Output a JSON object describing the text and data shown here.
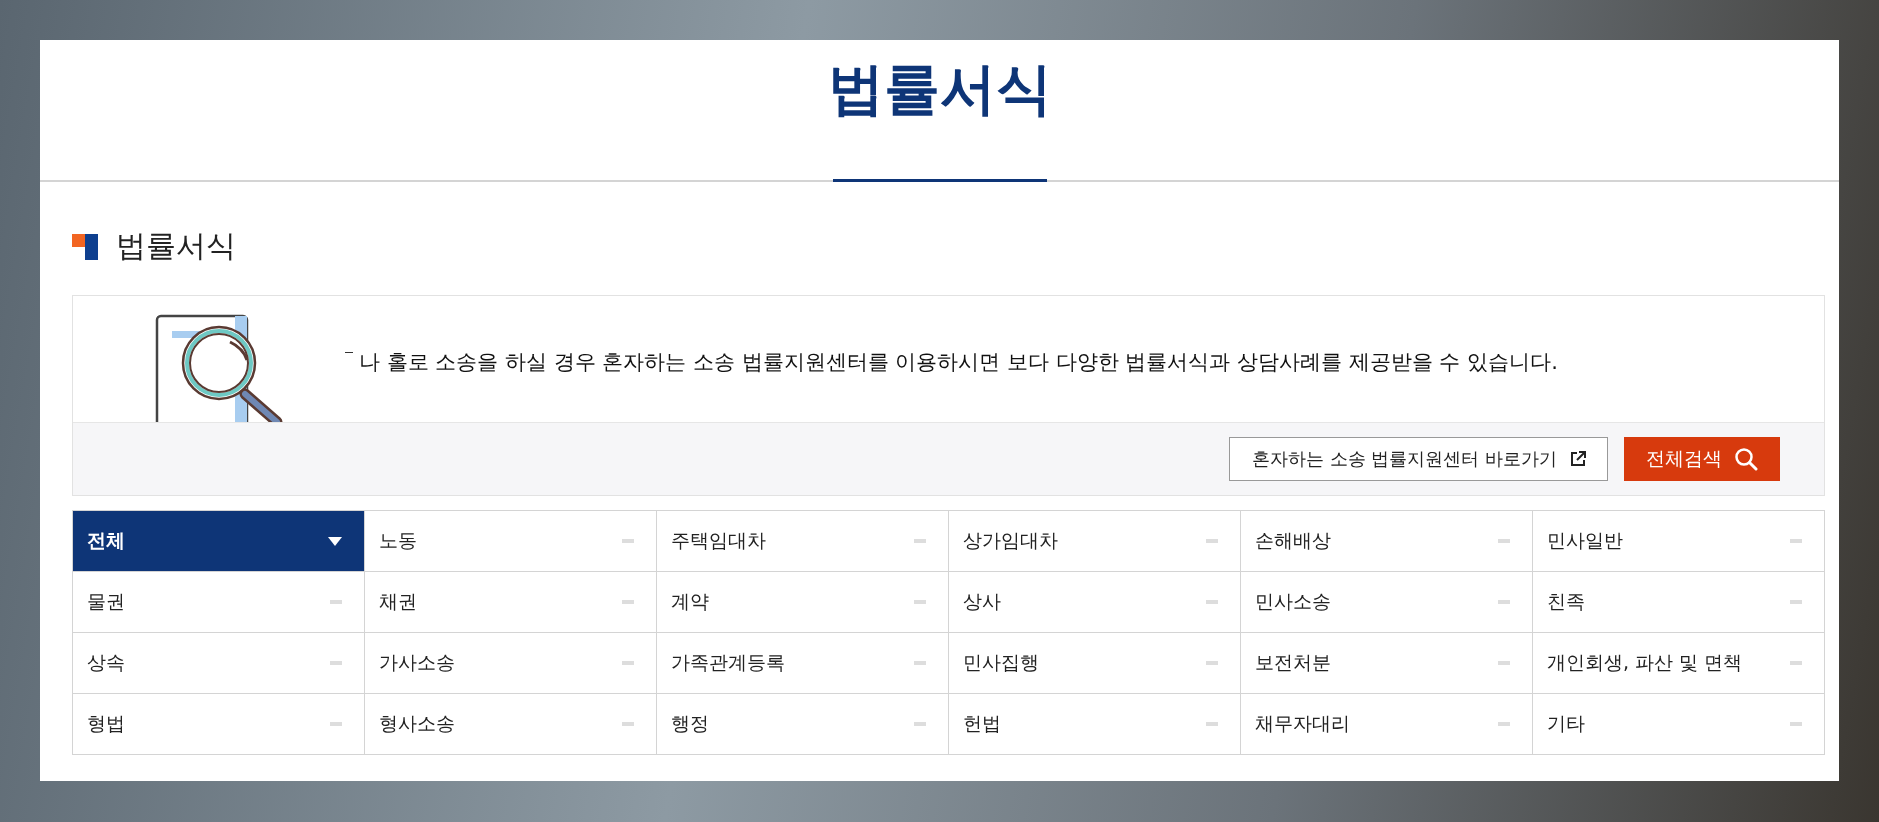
{
  "page_title": "법률서식",
  "section_title": "법률서식",
  "notice": {
    "text": "나 홀로 소송을 하실 경우 혼자하는 소송 법률지원센터를 이용하시면 보다 다양한 법률서식과 상담사례를 제공받을 수 있습니다."
  },
  "buttons": [
    {
      "kind": "link",
      "label": "혼자하는 소송 법률지원센터 바로가기"
    },
    {
      "kind": "search",
      "label": "전체검색"
    }
  ],
  "categories": [
    {
      "label": "전체",
      "selected": true
    },
    {
      "label": "노동",
      "selected": false
    },
    {
      "label": "주택임대차",
      "selected": false
    },
    {
      "label": "상가임대차",
      "selected": false
    },
    {
      "label": "손해배상",
      "selected": false
    },
    {
      "label": "민사일반",
      "selected": false
    },
    {
      "label": "물권",
      "selected": false
    },
    {
      "label": "채권",
      "selected": false
    },
    {
      "label": "계약",
      "selected": false
    },
    {
      "label": "상사",
      "selected": false
    },
    {
      "label": "민사소송",
      "selected": false
    },
    {
      "label": "친족",
      "selected": false
    },
    {
      "label": "상속",
      "selected": false
    },
    {
      "label": "가사소송",
      "selected": false
    },
    {
      "label": "가족관계등록",
      "selected": false
    },
    {
      "label": "민사집행",
      "selected": false
    },
    {
      "label": "보전처분",
      "selected": false
    },
    {
      "label": "개인회생, 파산 및 면책",
      "selected": false
    },
    {
      "label": "형법",
      "selected": false
    },
    {
      "label": "형사소송",
      "selected": false
    },
    {
      "label": "행정",
      "selected": false
    },
    {
      "label": "헌법",
      "selected": false
    },
    {
      "label": "채무자대리",
      "selected": false
    },
    {
      "label": "기타",
      "selected": false
    }
  ]
}
